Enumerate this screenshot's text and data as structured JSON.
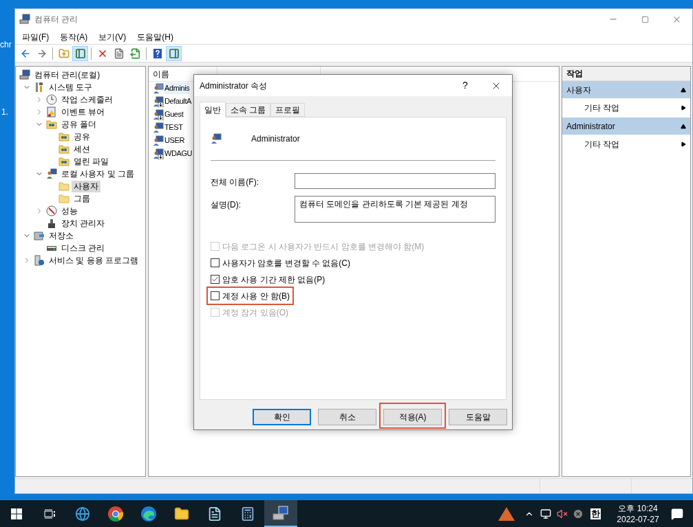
{
  "desktop": {
    "labels": [
      "chr",
      "1."
    ]
  },
  "window": {
    "title": "컴퓨터 관리"
  },
  "menu": [
    "파일(F)",
    "동작(A)",
    "보기(V)",
    "도움말(H)"
  ],
  "toolbar": [
    {
      "kind": "back",
      "pressed": false
    },
    {
      "kind": "forward",
      "pressed": false
    },
    {
      "kind": "separator"
    },
    {
      "kind": "up",
      "pressed": false
    },
    {
      "kind": "tree-pane",
      "pressed": true
    },
    {
      "kind": "separator"
    },
    {
      "kind": "delete",
      "pressed": false
    },
    {
      "kind": "properties",
      "pressed": false
    },
    {
      "kind": "export",
      "pressed": false
    },
    {
      "kind": "separator"
    },
    {
      "kind": "help",
      "pressed": false
    },
    {
      "kind": "action-pane",
      "pressed": true
    }
  ],
  "tree": [
    {
      "label": "컴퓨터 관리(로컬)",
      "kind": "computer",
      "selected": false,
      "children": [
        {
          "label": "시스템 도구",
          "kind": "tools",
          "expanded": true,
          "selected": false,
          "children": [
            {
              "label": "작업 스케줄러",
              "kind": "clock",
              "expanded": false,
              "selected": false
            },
            {
              "label": "이벤트 뷰어",
              "kind": "log",
              "expanded": false,
              "selected": false
            },
            {
              "label": "공유 폴더",
              "kind": "share",
              "expanded": true,
              "selected": false,
              "children": [
                {
                  "label": "공유",
                  "kind": "share",
                  "selected": false
                },
                {
                  "label": "세션",
                  "kind": "share",
                  "selected": false
                },
                {
                  "label": "열린 파일",
                  "kind": "share",
                  "selected": false
                }
              ]
            },
            {
              "label": "로컬 사용자 및 그룹",
              "kind": "users",
              "expanded": true,
              "selected": false,
              "children": [
                {
                  "label": "사용자",
                  "kind": "folder",
                  "selected": true
                },
                {
                  "label": "그룹",
                  "kind": "folder",
                  "selected": false
                }
              ]
            },
            {
              "label": "성능",
              "kind": "gauge",
              "expanded": false,
              "selected": false
            },
            {
              "label": "장치 관리자",
              "kind": "device",
              "selected": false
            }
          ]
        },
        {
          "label": "저장소",
          "kind": "storage",
          "expanded": true,
          "selected": false,
          "children": [
            {
              "label": "디스크 관리",
              "kind": "disk",
              "selected": false
            }
          ]
        },
        {
          "label": "서비스 및 응용 프로그램",
          "kind": "services",
          "expanded": false,
          "selected": false
        }
      ]
    }
  ],
  "list": {
    "column": "이름",
    "rows": [
      {
        "name": "Adminis",
        "selected": true,
        "disabled": false
      },
      {
        "name": "DefaultA",
        "selected": false,
        "disabled": true
      },
      {
        "name": "Guest",
        "selected": false,
        "disabled": true
      },
      {
        "name": "TEST",
        "selected": false,
        "disabled": false
      },
      {
        "name": "USER",
        "selected": false,
        "disabled": false
      },
      {
        "name": "WDAGU",
        "selected": false,
        "disabled": true
      }
    ]
  },
  "actions": {
    "title": "작업",
    "sections": [
      {
        "title": "사용자",
        "expanded": true,
        "items": [
          "기타 작업"
        ]
      },
      {
        "title": "Administrator",
        "expanded": true,
        "items": [
          "기타 작업"
        ]
      }
    ]
  },
  "dialog": {
    "title": "Administrator 속성",
    "help": "?",
    "tabs": [
      {
        "label": "일반",
        "selected": true
      },
      {
        "label": "소속 그룹",
        "selected": false
      },
      {
        "label": "프로필",
        "selected": false
      }
    ],
    "account": "Administrator",
    "fields": [
      {
        "label": "전체 이름(F):",
        "kind": "input"
      },
      {
        "label": "설명(D):",
        "value": "컴퓨터 도메인을 관리하도록 기본 제공된 계정",
        "kind": "textarea"
      }
    ],
    "options": [
      {
        "label": "다음 로그온 시 사용자가 반드시 암호를 변경해야 함(M)",
        "checked": false,
        "disabled": true,
        "highlighted": false
      },
      {
        "label": "사용자가 암호를 변경할 수 없음(C)",
        "checked": false,
        "disabled": false,
        "highlighted": false
      },
      {
        "label": "암호 사용 기간 제한 없음(P)",
        "checked": true,
        "disabled": false,
        "highlighted": false
      },
      {
        "label": "계정 사용 안 함(B)",
        "checked": false,
        "disabled": false,
        "highlighted": true
      },
      {
        "label": "계정 잠겨 있음(O)",
        "checked": false,
        "disabled": true,
        "highlighted": false
      }
    ],
    "buttons": [
      {
        "label": "확인",
        "default": true,
        "highlighted": false
      },
      {
        "label": "취소",
        "default": false,
        "highlighted": false
      },
      {
        "label": "적용(A)",
        "default": false,
        "highlighted": true
      },
      {
        "label": "도움말",
        "default": false,
        "highlighted": false
      }
    ]
  },
  "taskbar": {
    "ime": "한",
    "time": "오후 10:24",
    "date": "2022-07-27"
  }
}
